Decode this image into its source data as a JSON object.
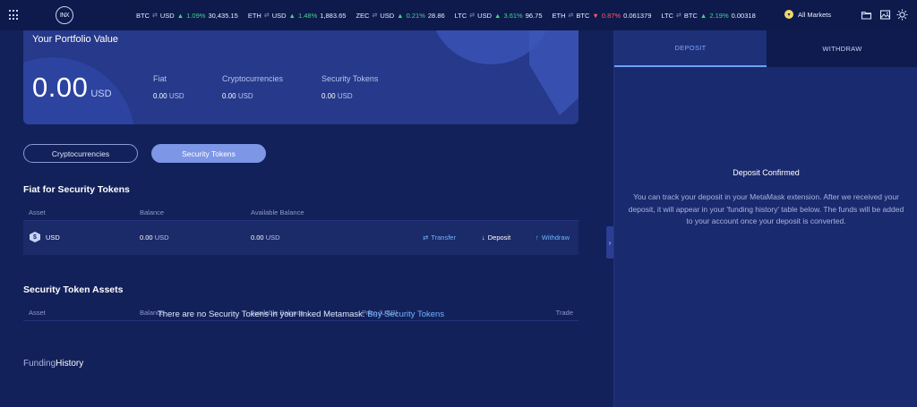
{
  "topbar": {
    "logo": "INX",
    "tickers": [
      {
        "base": "BTC",
        "quote": "USD",
        "change": "1.09%",
        "dir": "up",
        "price": "30,435.15"
      },
      {
        "base": "ETH",
        "quote": "USD",
        "change": "1.48%",
        "dir": "up",
        "price": "1,883.65"
      },
      {
        "base": "ZEC",
        "quote": "USD",
        "change": "0.21%",
        "dir": "up",
        "price": "28.86"
      },
      {
        "base": "LTC",
        "quote": "USD",
        "change": "3.61%",
        "dir": "up",
        "price": "96.75"
      },
      {
        "base": "ETH",
        "quote": "BTC",
        "change": "0.87%",
        "dir": "down",
        "price": "0.061379"
      },
      {
        "base": "LTC",
        "quote": "BTC",
        "change": "2.19%",
        "dir": "up",
        "price": "0.00318"
      }
    ],
    "markets_label": "All Markets"
  },
  "portfolio": {
    "title": "Your Portfolio Value",
    "value": "0.00",
    "currency": "USD",
    "columns": [
      {
        "label": "Fiat",
        "value": "0.00",
        "currency": "USD"
      },
      {
        "label": "Cryptocurrencies",
        "value": "0.00",
        "currency": "USD"
      },
      {
        "label": "Security Tokens",
        "value": "0.00",
        "currency": "USD"
      }
    ]
  },
  "toggle": {
    "option1": "Cryptocurrencies",
    "option2": "Security Tokens"
  },
  "fiat_section": {
    "title": "Fiat for Security Tokens",
    "headers": {
      "asset": "Asset",
      "balance": "Balance",
      "available": "Available Balance"
    },
    "row": {
      "asset": "USD",
      "balance": "0.00",
      "balance_cur": "USD",
      "available": "0.00",
      "available_cur": "USD",
      "transfer": "Transfer",
      "deposit": "Deposit",
      "withdraw": "Withdraw"
    }
  },
  "assets_section": {
    "title": "Security Token Assets",
    "headers": {
      "asset": "Asset",
      "balance": "Balance",
      "available": "Available Balance",
      "price": "Price (USD)",
      "trade": "Trade"
    },
    "empty_text": "There are no Security Tokens in your linked Metamask.",
    "empty_link": "Buy Security Tokens"
  },
  "funding": {
    "part1": "Funding",
    "part2": "History"
  },
  "right_panel": {
    "tab_deposit": "DEPOSIT",
    "tab_withdraw": "WITHDRAW",
    "confirm_title": "Deposit Confirmed",
    "confirm_text": "You can track your deposit in your MetaMask extension. After we received your deposit, it will appear in your 'funding history' table below. The funds will be added to your account once your deposit is converted."
  },
  "colors": {
    "background": "#13215a",
    "accent": "#7d96e6",
    "positive": "#3fd58b",
    "negative": "#ff5d6c",
    "link": "#6fb5ff"
  }
}
